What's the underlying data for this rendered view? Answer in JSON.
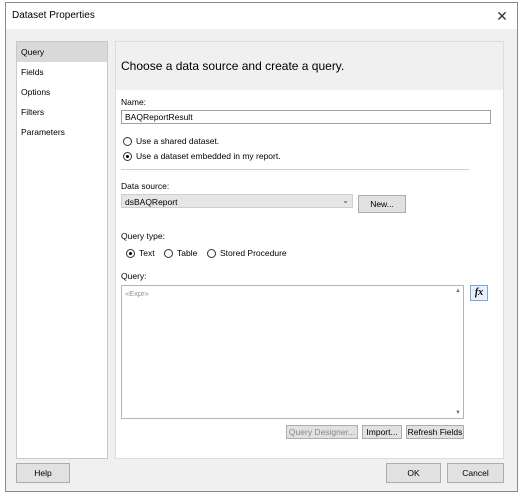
{
  "dialog": {
    "title": "Dataset Properties",
    "close_glyph": "✕"
  },
  "nav": {
    "items": [
      "Query",
      "Fields",
      "Options",
      "Filters",
      "Parameters"
    ],
    "selected": "Query"
  },
  "content": {
    "header": "Choose a data source and create a query.",
    "name_label": "Name:",
    "name_value": "BAQReportResult",
    "dataset_options": [
      {
        "label": "Use a shared dataset.",
        "checked": false
      },
      {
        "label": "Use a dataset embedded in my report.",
        "checked": true
      }
    ],
    "datasource_label": "Data source:",
    "datasource_value": "dsBAQReport",
    "new_button": "New...",
    "query_type_label": "Query type:",
    "query_types": [
      {
        "label": "Text",
        "checked": true
      },
      {
        "label": "Table",
        "checked": false
      },
      {
        "label": "Stored Procedure",
        "checked": false
      }
    ],
    "query_label": "Query:",
    "query_placeholder": "«Expr»",
    "fx_glyph": "fx",
    "query_designer_button": "Query Designer...",
    "import_button": "Import...",
    "refresh_button": "Refresh Fields"
  },
  "footer": {
    "help": "Help",
    "ok": "OK",
    "cancel": "Cancel"
  }
}
